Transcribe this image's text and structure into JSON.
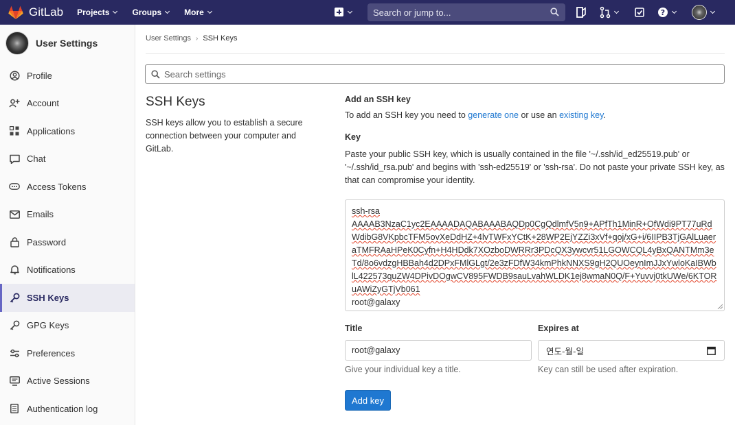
{
  "navbar": {
    "brand": "GitLab",
    "menu": [
      {
        "label": "Projects"
      },
      {
        "label": "Groups"
      },
      {
        "label": "More"
      }
    ],
    "search_placeholder": "Search or jump to..."
  },
  "sidebar": {
    "title": "User Settings",
    "items": [
      {
        "label": "Profile",
        "icon": "profile-icon"
      },
      {
        "label": "Account",
        "icon": "account-icon"
      },
      {
        "label": "Applications",
        "icon": "applications-icon"
      },
      {
        "label": "Chat",
        "icon": "chat-icon"
      },
      {
        "label": "Access Tokens",
        "icon": "token-icon"
      },
      {
        "label": "Emails",
        "icon": "mail-icon"
      },
      {
        "label": "Password",
        "icon": "lock-icon"
      },
      {
        "label": "Notifications",
        "icon": "bell-icon"
      },
      {
        "label": "SSH Keys",
        "icon": "key-icon",
        "active": true
      },
      {
        "label": "GPG Keys",
        "icon": "key-icon"
      },
      {
        "label": "Preferences",
        "icon": "preferences-icon"
      },
      {
        "label": "Active Sessions",
        "icon": "monitor-icon"
      },
      {
        "label": "Authentication log",
        "icon": "log-icon"
      }
    ]
  },
  "breadcrumb": {
    "parent": "User Settings",
    "current": "SSH Keys"
  },
  "settings_search": {
    "placeholder": "Search settings"
  },
  "section": {
    "title": "SSH Keys",
    "description": "SSH keys allow you to establish a secure connection between your computer and GitLab."
  },
  "form": {
    "heading": "Add an SSH key",
    "intro_prefix": "To add an SSH key you need to ",
    "intro_link1": "generate one",
    "intro_middle": " or use an ",
    "intro_link2": "existing key",
    "intro_suffix": ".",
    "key_label": "Key",
    "key_help": "Paste your public SSH key, which is usually contained in the file '~/.ssh/id_ed25519.pub' or '~/.ssh/id_rsa.pub' and begins with 'ssh-ed25519' or 'ssh-rsa'. Do not paste your private SSH key, as that can compromise your identity.",
    "key_type": "ssh-rsa",
    "key_body": "AAAAB3NzaC1yc2EAAAADAQABAAABAQDp0CgQdlmfV5n9+APfTh1MinR+OfWdi9PT77uRdWdibG8VKpbcTFM5ovXeDdHZ+4lvTWFxYCtK+28WP2EjYZZi3xVf+qoj/xG+i/6IIPB3TjGAlLuaeraTMFRAaHPeK0Cyfn+H4HDdk7XOzboDWRRr3PDcQX3ywcvr51LGOWCQL4yBxQANTMm3eTd/8o6vdzgHBBah4d2DPxFMlGLgt/2e3zFDfW34kmPhkNNXS9gH2QUOeynImJJxYwloKaIBWblL422573quZW4DPivDOgwCV895FWDB9sauLvahWLDK1ej8wmaN0Q/F+Yuvvj0tkUWe/6KTORuAWiZyGTjVb061",
    "key_comment": "root@galaxy",
    "title_label": "Title",
    "title_value": "root@galaxy",
    "title_help": "Give your individual key a title.",
    "expires_label": "Expires at",
    "expires_value": "연도-월-일",
    "expires_help": "Key can still be used after expiration.",
    "submit_label": "Add key"
  }
}
